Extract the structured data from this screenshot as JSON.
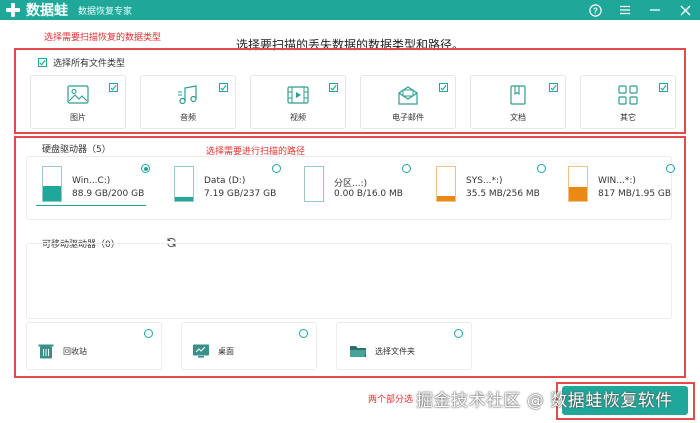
{
  "app": {
    "name": "数据蛙",
    "subtitle": "数据恢复专家"
  },
  "window_controls": [
    "help-icon",
    "menu-icon",
    "minimize-icon",
    "close-icon"
  ],
  "instruction": "选择要扫描的丢失数据的数据类型和路径。",
  "annotations": {
    "select_types": "选择需要扫描恢复的数据类型",
    "select_path": "选择需要进行扫描的路径",
    "bottom": "两个部分选"
  },
  "file_types": {
    "select_all_label": "选择所有文件类型",
    "select_all_checked": true,
    "items": [
      {
        "label": "图片",
        "icon": "image-icon",
        "checked": true
      },
      {
        "label": "音频",
        "icon": "music-icon",
        "checked": true
      },
      {
        "label": "视频",
        "icon": "video-icon",
        "checked": true
      },
      {
        "label": "电子邮件",
        "icon": "email-icon",
        "checked": true
      },
      {
        "label": "文档",
        "icon": "document-icon",
        "checked": true
      },
      {
        "label": "其它",
        "icon": "other-icon",
        "checked": true
      }
    ]
  },
  "hard_drives": {
    "label": "硬盘驱动器（5）",
    "items": [
      {
        "name": "Win...C:)",
        "size": "88.9 GB/200 GB",
        "used": 0.44,
        "selected": true,
        "color": "#1fa89a"
      },
      {
        "name": "Data (D:)",
        "size": "7.19 GB/237 GB",
        "used": 0.03,
        "selected": false,
        "color": "#1fa89a"
      },
      {
        "name": "分区...:)",
        "size": "0.00  B/16.0 MB",
        "used": 0.0,
        "selected": false,
        "color": "#1fa89a"
      },
      {
        "name": "SYS...*:)",
        "size": "35.5 MB/256 MB",
        "used": 0.14,
        "selected": false,
        "color": "#e98a12"
      },
      {
        "name": "WIN...*:)",
        "size": "817 MB/1.95 GB",
        "used": 0.42,
        "selected": false,
        "color": "#e98a12"
      }
    ]
  },
  "removable": {
    "label": "可移动驱动器（0）"
  },
  "locations": [
    {
      "label": "回收站",
      "icon": "recycle-bin-icon"
    },
    {
      "label": "桌面",
      "icon": "desktop-icon"
    },
    {
      "label": "选择文件夹",
      "icon": "folder-icon"
    }
  ],
  "watermark": "掘金技术社区 @ 数据蛙恢复软件",
  "colors": {
    "accent": "#1fa89a",
    "annotation": "#e34a4a",
    "warning": "#e98a12"
  }
}
